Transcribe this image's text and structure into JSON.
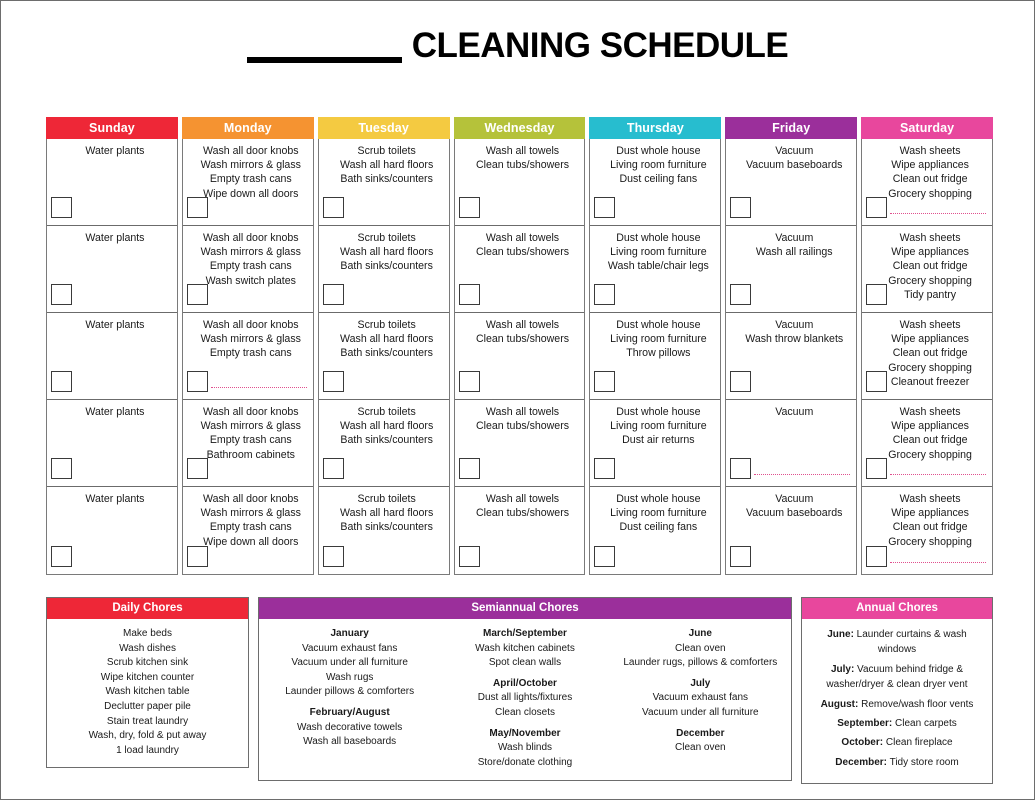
{
  "title": {
    "blank_label": "",
    "text": "CLEANING SCHEDULE"
  },
  "colors": {
    "sunday": "#ee2737",
    "monday": "#f59331",
    "tuesday": "#f4ca41",
    "wednesday": "#b5c23a",
    "thursday": "#27bdcf",
    "friday": "#9b2f9b",
    "saturday": "#e8479d",
    "daily": "#ee2737",
    "semiannual": "#9b2f9b",
    "annual": "#e8479d",
    "dotted_line": "#e0508e"
  },
  "week": {
    "columns": [
      {
        "day": "Sunday",
        "color_key": "sunday",
        "cells": [
          {
            "tasks": [
              "Water plants"
            ],
            "dotted": false
          },
          {
            "tasks": [
              "Water plants"
            ],
            "dotted": false
          },
          {
            "tasks": [
              "Water plants"
            ],
            "dotted": false
          },
          {
            "tasks": [
              "Water plants"
            ],
            "dotted": false
          },
          {
            "tasks": [
              "Water plants"
            ],
            "dotted": false
          }
        ]
      },
      {
        "day": "Monday",
        "color_key": "monday",
        "cells": [
          {
            "tasks": [
              "Wash all door knobs",
              "Wash mirrors & glass",
              "Empty trash cans",
              "Wipe down all doors"
            ],
            "dotted": false
          },
          {
            "tasks": [
              "Wash all door knobs",
              "Wash mirrors & glass",
              "Empty trash cans",
              "Wash switch plates"
            ],
            "dotted": false
          },
          {
            "tasks": [
              "Wash all door knobs",
              "Wash mirrors & glass",
              "Empty trash cans"
            ],
            "dotted": true
          },
          {
            "tasks": [
              "Wash all door knobs",
              "Wash mirrors & glass",
              "Empty trash cans",
              "Bathroom cabinets"
            ],
            "dotted": false
          },
          {
            "tasks": [
              "Wash all door knobs",
              "Wash mirrors & glass",
              "Empty trash cans",
              "Wipe down all doors"
            ],
            "dotted": false
          }
        ]
      },
      {
        "day": "Tuesday",
        "color_key": "tuesday",
        "cells": [
          {
            "tasks": [
              "Scrub toilets",
              "Wash all hard floors",
              "Bath sinks/counters"
            ],
            "dotted": false
          },
          {
            "tasks": [
              "Scrub toilets",
              "Wash all hard floors",
              "Bath sinks/counters"
            ],
            "dotted": false
          },
          {
            "tasks": [
              "Scrub toilets",
              "Wash all hard floors",
              "Bath sinks/counters"
            ],
            "dotted": false
          },
          {
            "tasks": [
              "Scrub toilets",
              "Wash all hard floors",
              "Bath sinks/counters"
            ],
            "dotted": false
          },
          {
            "tasks": [
              "Scrub toilets",
              "Wash all hard floors",
              "Bath sinks/counters"
            ],
            "dotted": false
          }
        ]
      },
      {
        "day": "Wednesday",
        "color_key": "wednesday",
        "cells": [
          {
            "tasks": [
              "Wash all towels",
              "Clean tubs/showers"
            ],
            "dotted": false
          },
          {
            "tasks": [
              "Wash all towels",
              "Clean tubs/showers"
            ],
            "dotted": false
          },
          {
            "tasks": [
              "Wash all towels",
              "Clean tubs/showers"
            ],
            "dotted": false
          },
          {
            "tasks": [
              "Wash all towels",
              "Clean tubs/showers"
            ],
            "dotted": false
          },
          {
            "tasks": [
              "Wash all towels",
              "Clean tubs/showers"
            ],
            "dotted": false
          }
        ]
      },
      {
        "day": "Thursday",
        "color_key": "thursday",
        "cells": [
          {
            "tasks": [
              "Dust whole house",
              "Living room furniture",
              "Dust ceiling fans"
            ],
            "dotted": false
          },
          {
            "tasks": [
              "Dust whole house",
              "Living room furniture",
              "Wash table/chair legs"
            ],
            "dotted": false
          },
          {
            "tasks": [
              "Dust whole house",
              "Living room furniture",
              "Throw pillows"
            ],
            "dotted": false
          },
          {
            "tasks": [
              "Dust whole house",
              "Living room furniture",
              "Dust air returns"
            ],
            "dotted": false
          },
          {
            "tasks": [
              "Dust whole house",
              "Living room furniture",
              "Dust ceiling fans"
            ],
            "dotted": false
          }
        ]
      },
      {
        "day": "Friday",
        "color_key": "friday",
        "cells": [
          {
            "tasks": [
              "Vacuum",
              "Vacuum baseboards"
            ],
            "dotted": false
          },
          {
            "tasks": [
              "Vacuum",
              "Wash all railings"
            ],
            "dotted": false
          },
          {
            "tasks": [
              "Vacuum",
              "Wash throw blankets"
            ],
            "dotted": false
          },
          {
            "tasks": [
              "Vacuum"
            ],
            "dotted": true
          },
          {
            "tasks": [
              "Vacuum",
              "Vacuum baseboards"
            ],
            "dotted": false
          }
        ]
      },
      {
        "day": "Saturday",
        "color_key": "saturday",
        "cells": [
          {
            "tasks": [
              "Wash sheets",
              "Wipe appliances",
              "Clean out fridge",
              "Grocery shopping"
            ],
            "dotted": true
          },
          {
            "tasks": [
              "Wash sheets",
              "Wipe appliances",
              "Clean out fridge",
              "Grocery shopping",
              "Tidy pantry"
            ],
            "dotted": false
          },
          {
            "tasks": [
              "Wash sheets",
              "Wipe appliances",
              "Clean out fridge",
              "Grocery shopping",
              "Cleanout freezer"
            ],
            "dotted": false
          },
          {
            "tasks": [
              "Wash sheets",
              "Wipe appliances",
              "Clean out fridge",
              "Grocery shopping"
            ],
            "dotted": true
          },
          {
            "tasks": [
              "Wash sheets",
              "Wipe appliances",
              "Clean out fridge",
              "Grocery shopping"
            ],
            "dotted": true
          }
        ]
      }
    ]
  },
  "daily_chores": {
    "title": "Daily Chores",
    "items": [
      "Make beds",
      "Wash dishes",
      "Scrub kitchen sink",
      "Wipe kitchen counter",
      "Wash kitchen table",
      "Declutter paper pile",
      "Stain treat laundry",
      "Wash, dry, fold & put away",
      "1 load laundry"
    ]
  },
  "semiannual_chores": {
    "title": "Semiannual Chores",
    "columns": [
      {
        "groups": [
          {
            "heading": "January",
            "items": [
              "Vacuum exhaust fans",
              "Vacuum under all furniture",
              "Wash rugs",
              "Launder pillows & comforters"
            ]
          },
          {
            "heading": "February/August",
            "items": [
              "Wash decorative towels",
              "Wash all baseboards"
            ]
          }
        ]
      },
      {
        "groups": [
          {
            "heading": "March/September",
            "items": [
              "Wash kitchen cabinets",
              "Spot clean walls"
            ]
          },
          {
            "heading": "April/October",
            "items": [
              "Dust all lights/fixtures",
              "Clean closets"
            ]
          },
          {
            "heading": "May/November",
            "items": [
              "Wash blinds",
              "Store/donate clothing"
            ]
          }
        ]
      },
      {
        "groups": [
          {
            "heading": "June",
            "items": [
              "Clean oven",
              "Launder rugs, pillows & comforters"
            ]
          },
          {
            "heading": "July",
            "items": [
              "Vacuum exhaust fans",
              "Vacuum under all furniture"
            ]
          },
          {
            "heading": "December",
            "items": [
              "Clean oven"
            ]
          }
        ]
      }
    ]
  },
  "annual_chores": {
    "title": "Annual Chores",
    "entries": [
      {
        "month": "June:",
        "text": " Launder curtains & wash windows"
      },
      {
        "month": "July:",
        "text": " Vacuum behind fridge & washer/dryer & clean dryer vent"
      },
      {
        "month": "August:",
        "text": " Remove/wash floor vents"
      },
      {
        "month": "September:",
        "text": " Clean carpets"
      },
      {
        "month": "October:",
        "text": " Clean fireplace"
      },
      {
        "month": "December:",
        "text": " Tidy store room"
      }
    ]
  }
}
